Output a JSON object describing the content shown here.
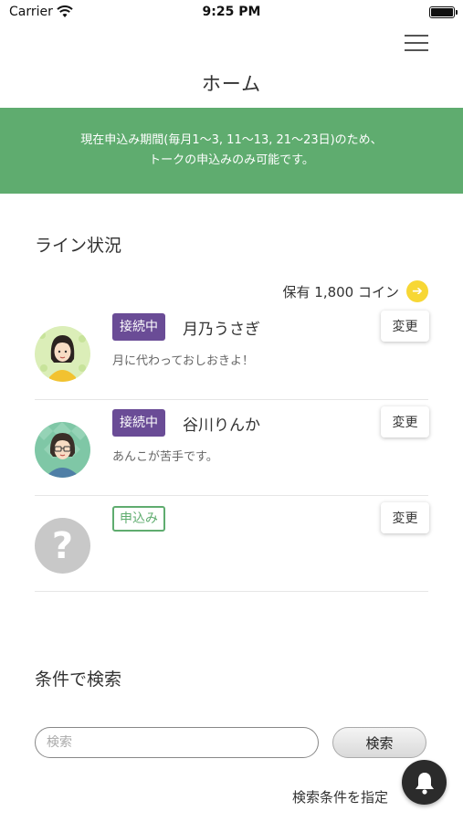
{
  "status_bar": {
    "carrier": "Carrier",
    "time": "9:25 PM"
  },
  "header": {
    "title": "ホーム"
  },
  "banner": {
    "line1": "現在申込み期間(毎月1〜3, 11〜13, 21〜23日)のため、",
    "line2": "トークの申込みのみ可能です。",
    "color": "#5fac6f"
  },
  "line_status": {
    "title": "ライン状況",
    "coins_label": "保有 1,800 コイン",
    "items": [
      {
        "badge": "接続中",
        "name": "月乃うさぎ",
        "message": "月に代わっておしおきよ！",
        "change_label": "変更"
      },
      {
        "badge": "接続中",
        "name": "谷川りんか",
        "message": "あんこが苦手です。",
        "change_label": "変更"
      },
      {
        "badge": "申込み",
        "name": "",
        "message": "",
        "change_label": "変更"
      }
    ]
  },
  "search": {
    "title": "条件で検索",
    "placeholder": "検索",
    "button_label": "検索",
    "condition_link": "検索条件を指定"
  },
  "colors": {
    "accent_green": "#5fac6f",
    "badge_purple": "#6a4c96",
    "coin_yellow": "#f7d735"
  },
  "icons": [
    "wifi-icon",
    "battery-icon",
    "hamburger-menu-icon",
    "arrow-right-icon",
    "question-mark-icon",
    "bell-icon"
  ]
}
